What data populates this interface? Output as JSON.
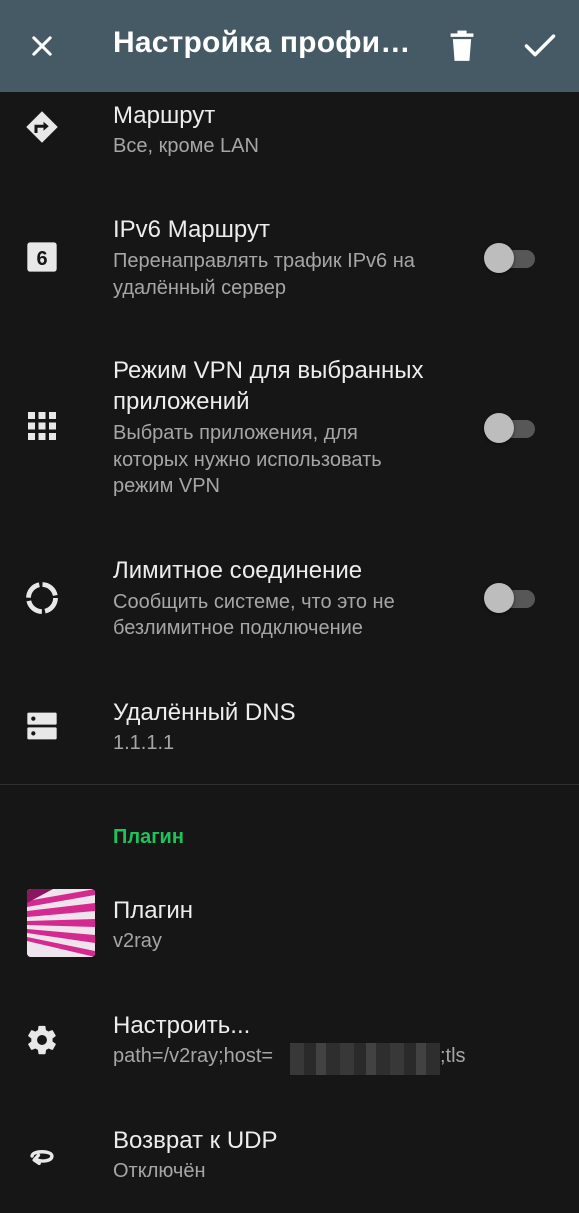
{
  "toolbar": {
    "title": "Настройка профи…",
    "close_icon": "close-icon",
    "delete_icon": "delete-icon",
    "apply_icon": "check-icon",
    "color": "#455a64"
  },
  "items": {
    "route": {
      "title": "Маршрут",
      "summary": "Все, кроме LAN",
      "icon": "route-icon"
    },
    "ipv6": {
      "title": "IPv6 Маршрут",
      "summary_line1": "Перенаправлять трафик IPv6 на",
      "summary_line2": "удалённый сервер",
      "icon": "ipv6-icon",
      "checked": false
    },
    "per_app": {
      "title_line1": "Режим VPN для выбранных",
      "title_line2": "приложений",
      "summary_line1": "Выбрать приложения, для",
      "summary_line2": "которых нужно использовать",
      "summary_line3": "режим VPN",
      "icon": "apps-grid-icon",
      "checked": false
    },
    "metered": {
      "title": "Лимитное соединение",
      "summary_line1": "Сообщить системе, что это не",
      "summary_line2": "безлимитное подключение",
      "icon": "metered-icon",
      "checked": false
    },
    "remote_dns": {
      "title": "Удалённый DNS",
      "summary": "1.1.1.1",
      "icon": "dns-icon"
    }
  },
  "plugin_category": {
    "label": "Плагин",
    "color": "#1ec35a"
  },
  "plugin_items": {
    "plugin": {
      "title": "Плагин",
      "summary": "v2ray",
      "icon": "v2ray-logo"
    },
    "configure": {
      "title": "Настроить...",
      "summary_prefix": "path=/v2ray;host=",
      "summary_suffix": ";tls",
      "icon": "gear-icon"
    },
    "udp_fallback": {
      "title": "Возврат к UDP",
      "summary": "Отключён",
      "icon": "udp-fallback-icon"
    }
  }
}
